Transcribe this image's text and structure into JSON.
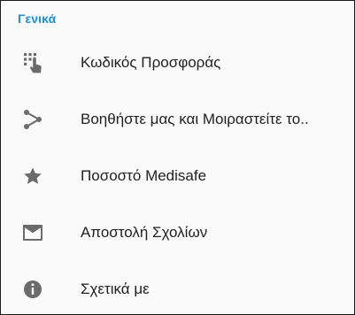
{
  "section": {
    "title": "Γενικά"
  },
  "items": [
    {
      "label": "Κωδικός Προσφοράς",
      "icon": "dialpad-touch-icon"
    },
    {
      "label": "Βοηθήστε μας και Μοιραστείτε το..",
      "icon": "share-icon"
    },
    {
      "label": "Ποσοστό Medisafe",
      "icon": "star-icon"
    },
    {
      "label": "Αποστολή Σχολίων",
      "icon": "envelope-icon"
    },
    {
      "label": "Σχετικά με",
      "icon": "info-icon"
    }
  ],
  "colors": {
    "accent": "#1b8fd3",
    "icon": "#6b6b6b",
    "text": "#222222",
    "background": "#fafafa"
  }
}
